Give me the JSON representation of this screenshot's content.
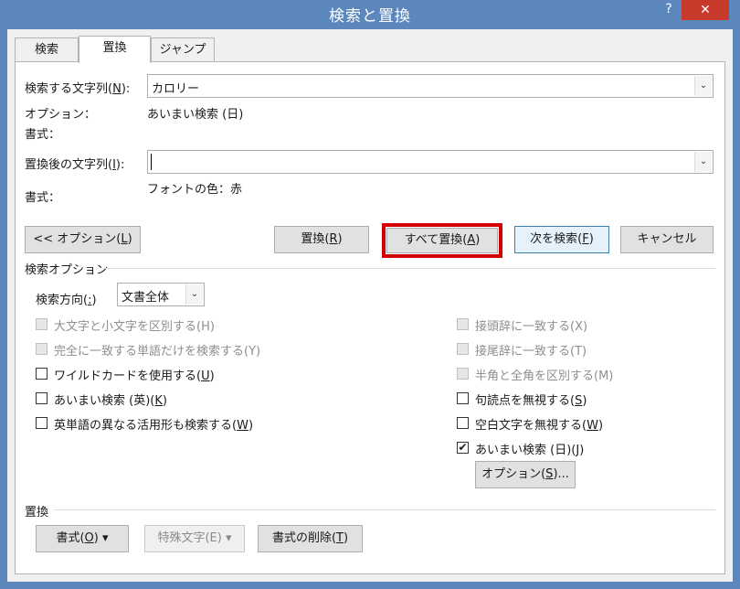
{
  "window": {
    "title": "検索と置換",
    "help": "?",
    "close": "✕"
  },
  "tabs": [
    "検索",
    "置換",
    "ジャンプ"
  ],
  "search": {
    "label": "検索する文字列(",
    "key": "N",
    "end": "):",
    "value": "カロリー"
  },
  "options_label": "オプション：",
  "options_value": "あいまい検索 (日)",
  "format_label_1": "書式：",
  "replace": {
    "label": "置換後の文字列(",
    "key": "I",
    "end": "):",
    "value": ""
  },
  "format_label_2": "書式：",
  "format_value_2": "フォントの色：赤",
  "buttons": {
    "options": {
      "pre": "<< オプション(",
      "key": "L",
      "end": ")"
    },
    "replace": {
      "pre": "置換(",
      "key": "R",
      "end": ")"
    },
    "replace_all": {
      "pre": "すべて置換(",
      "key": "A",
      "end": ")"
    },
    "find_next": {
      "pre": "次を検索(",
      "key": "F",
      "end": ")"
    },
    "cancel": "キャンセル"
  },
  "search_options": {
    "header": "検索オプション",
    "direction_label": {
      "pre": "検索方向(",
      "key": ":",
      "end": ")"
    },
    "direction_value": "文書全体"
  },
  "left_checks": [
    {
      "label": "大文字と小文字を区別する(H)",
      "enabled": false,
      "checked": false
    },
    {
      "label": "完全に一致する単語だけを検索する(Y)",
      "enabled": false,
      "checked": false
    },
    {
      "pre": "ワイルドカードを使用する(",
      "key": "U",
      "end": ")",
      "enabled": true,
      "checked": false
    },
    {
      "pre": "あいまい検索 (英)(",
      "key": "K",
      "end": ")",
      "enabled": true,
      "checked": false
    },
    {
      "pre": "英単語の異なる活用形も検索する(",
      "key": "W",
      "end": ")",
      "enabled": true,
      "checked": false
    }
  ],
  "right_checks": [
    {
      "label": "接頭辞に一致する(X)",
      "enabled": false,
      "checked": false
    },
    {
      "label": "接尾辞に一致する(T)",
      "enabled": false,
      "checked": false
    },
    {
      "label": "半角と全角を区別する(M)",
      "enabled": false,
      "checked": false
    },
    {
      "pre": "句読点を無視する(",
      "key": "S",
      "end": ")",
      "enabled": true,
      "checked": false
    },
    {
      "pre": "空白文字を無視する(",
      "key": "W",
      "end": ")",
      "enabled": true,
      "checked": false
    },
    {
      "pre": "あいまい検索 (日)(",
      "key": "J",
      "end": ")",
      "enabled": true,
      "checked": true
    }
  ],
  "fuzzy_options_btn": {
    "pre": "オプション(",
    "key": "S",
    "end": ")..."
  },
  "replace_section": {
    "header": "置換",
    "format_btn": {
      "pre": "書式(",
      "key": "O",
      "end": ")"
    },
    "special_btn": "特殊文字(E)",
    "remove_format_btn": {
      "pre": "書式の削除(",
      "key": "T",
      "end": ")"
    }
  },
  "dropdown_glyph": "⌄",
  "check_glyph": "✔",
  "colors": {
    "title_bar": "#5b87bd",
    "close": "#c7392b",
    "highlight": "#d40000"
  }
}
